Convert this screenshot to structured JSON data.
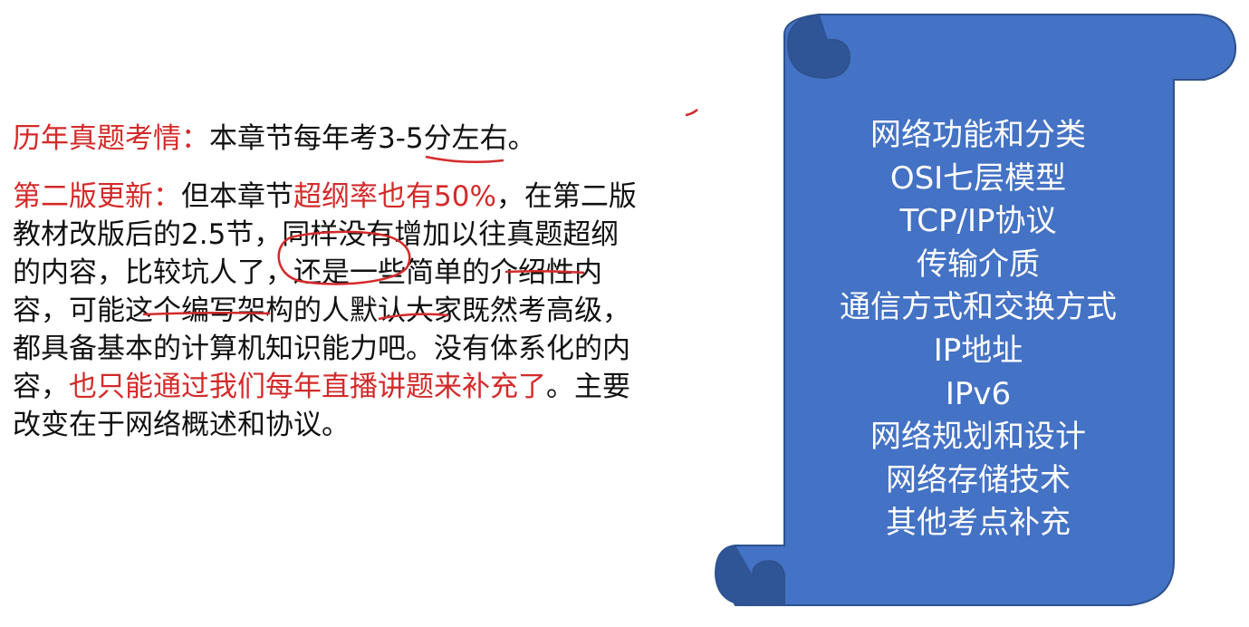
{
  "exam_info": {
    "label": "历年真题考情：",
    "text_before": "本章节每年考",
    "score": "3-5分",
    "text_after": "左右。"
  },
  "update": {
    "label": "第二版更新：",
    "s1": "但本章节",
    "s2_red": "超纲率也有50%",
    "s3": "，在第二版教材改版后的2.5节，同样没有增加以往真题超纲的内容，比较坑人了，还是一些简单的介绍性内容，可能这个编写架构的人默认大家既然考高级，都具备基本的计算机知识能力吧。没有体系化的内容，",
    "s4_red": "也只能通过我们每年直播讲题来补充了",
    "s5": "。主要改变在于网络概述和协议。"
  },
  "topics": [
    "网络功能和分类",
    "OSI七层模型",
    "TCP/IP协议",
    "传输介质",
    "通信方式和交换方式",
    "IP地址",
    "IPv6",
    "网络规划和设计",
    "网络存储技术",
    "其他考点补充"
  ],
  "colors": {
    "red": "#d42a2a",
    "scroll_fill": "#4472c4",
    "scroll_stroke": "#2f528f",
    "scroll_shadow": "#2f5597"
  }
}
